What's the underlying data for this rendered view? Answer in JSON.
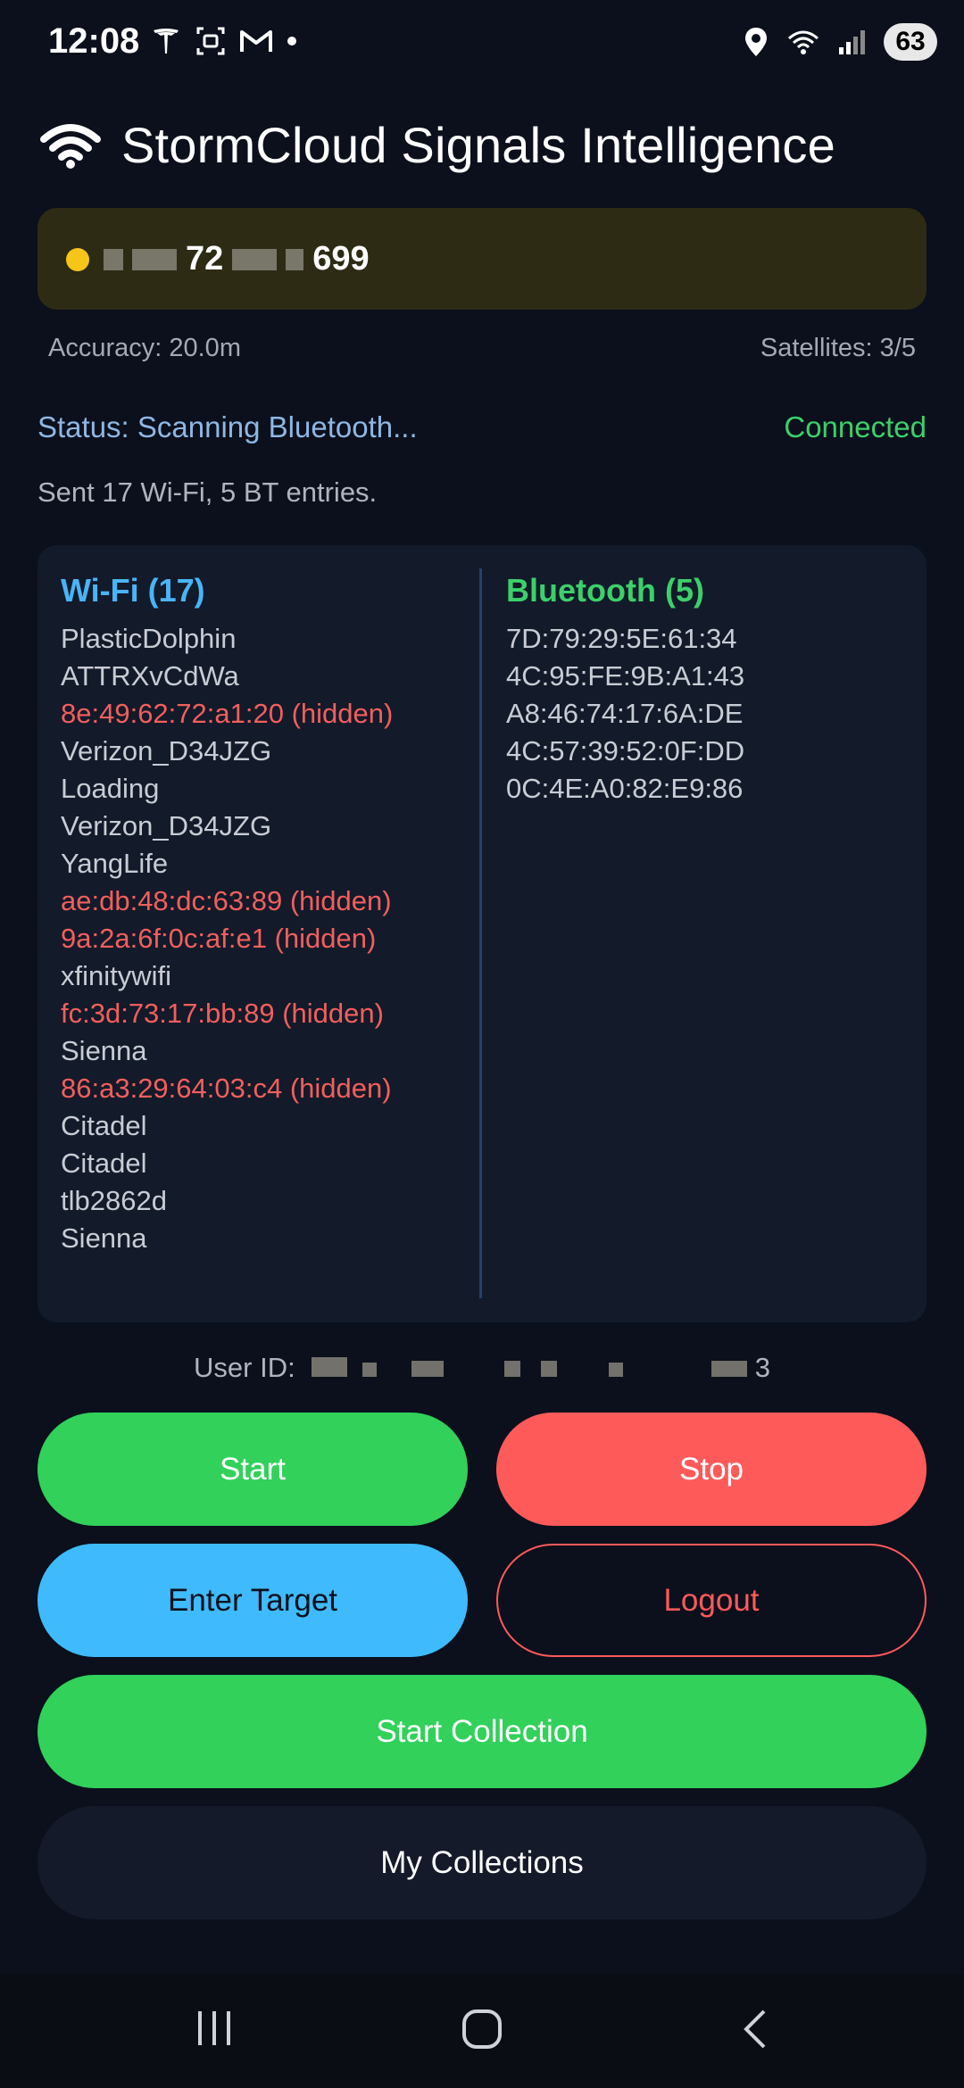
{
  "status_bar": {
    "time": "12:08",
    "left_icons": [
      "tesla-icon",
      "scan-icon",
      "gmail-icon",
      "dot-icon"
    ],
    "right_icons": [
      "location-icon",
      "wifi-icon",
      "signal-icon"
    ],
    "battery": "63"
  },
  "header": {
    "title": "StormCloud Signals Intelligence",
    "icon": "wifi-icon"
  },
  "location": {
    "coordinates_partial_1": "72",
    "coordinates_partial_2": "699",
    "indicator_color": "#f5c518"
  },
  "gps": {
    "accuracy": "Accuracy: 20.0m",
    "satellites": "Satellites: 3/5"
  },
  "status": {
    "text": "Status: Scanning Bluetooth...",
    "connection": "Connected",
    "sent": "Sent 17 Wi-Fi, 5 BT entries."
  },
  "wifi": {
    "heading": "Wi-Fi (17)",
    "entries": [
      {
        "text": "PlasticDolphin",
        "hidden": false
      },
      {
        "text": "ATTRXvCdWa",
        "hidden": false
      },
      {
        "text": "8e:49:62:72:a1:20 (hidden)",
        "hidden": true
      },
      {
        "text": "Verizon_D34JZG",
        "hidden": false
      },
      {
        "text": "Loading",
        "hidden": false
      },
      {
        "text": "Verizon_D34JZG",
        "hidden": false
      },
      {
        "text": "YangLife",
        "hidden": false
      },
      {
        "text": "ae:db:48:dc:63:89 (hidden)",
        "hidden": true
      },
      {
        "text": "9a:2a:6f:0c:af:e1 (hidden)",
        "hidden": true
      },
      {
        "text": "xfinitywifi",
        "hidden": false
      },
      {
        "text": "fc:3d:73:17:bb:89 (hidden)",
        "hidden": true
      },
      {
        "text": "Sienna",
        "hidden": false
      },
      {
        "text": "86:a3:29:64:03:c4 (hidden)",
        "hidden": true
      },
      {
        "text": "Citadel",
        "hidden": false
      },
      {
        "text": "Citadel",
        "hidden": false
      },
      {
        "text": "tlb2862d",
        "hidden": false
      },
      {
        "text": "Sienna",
        "hidden": false
      }
    ]
  },
  "bluetooth": {
    "heading": "Bluetooth (5)",
    "entries": [
      "7D:79:29:5E:61:34",
      "4C:95:FE:9B:A1:43",
      "A8:46:74:17:6A:DE",
      "4C:57:39:52:0F:DD",
      "0C:4E:A0:82:E9:86"
    ]
  },
  "user": {
    "label": "User ID:",
    "id_suffix": "3"
  },
  "buttons": {
    "start": "Start",
    "stop": "Stop",
    "enter_target": "Enter Target",
    "logout": "Logout",
    "start_collection": "Start Collection",
    "my_collections": "My Collections"
  },
  "colors": {
    "background": "#0b101c",
    "green": "#31d15a",
    "red": "#ff5a5a",
    "blue": "#3fbbfd",
    "wifi_heading": "#49b4f7",
    "hidden_entry": "#f25f5c"
  }
}
